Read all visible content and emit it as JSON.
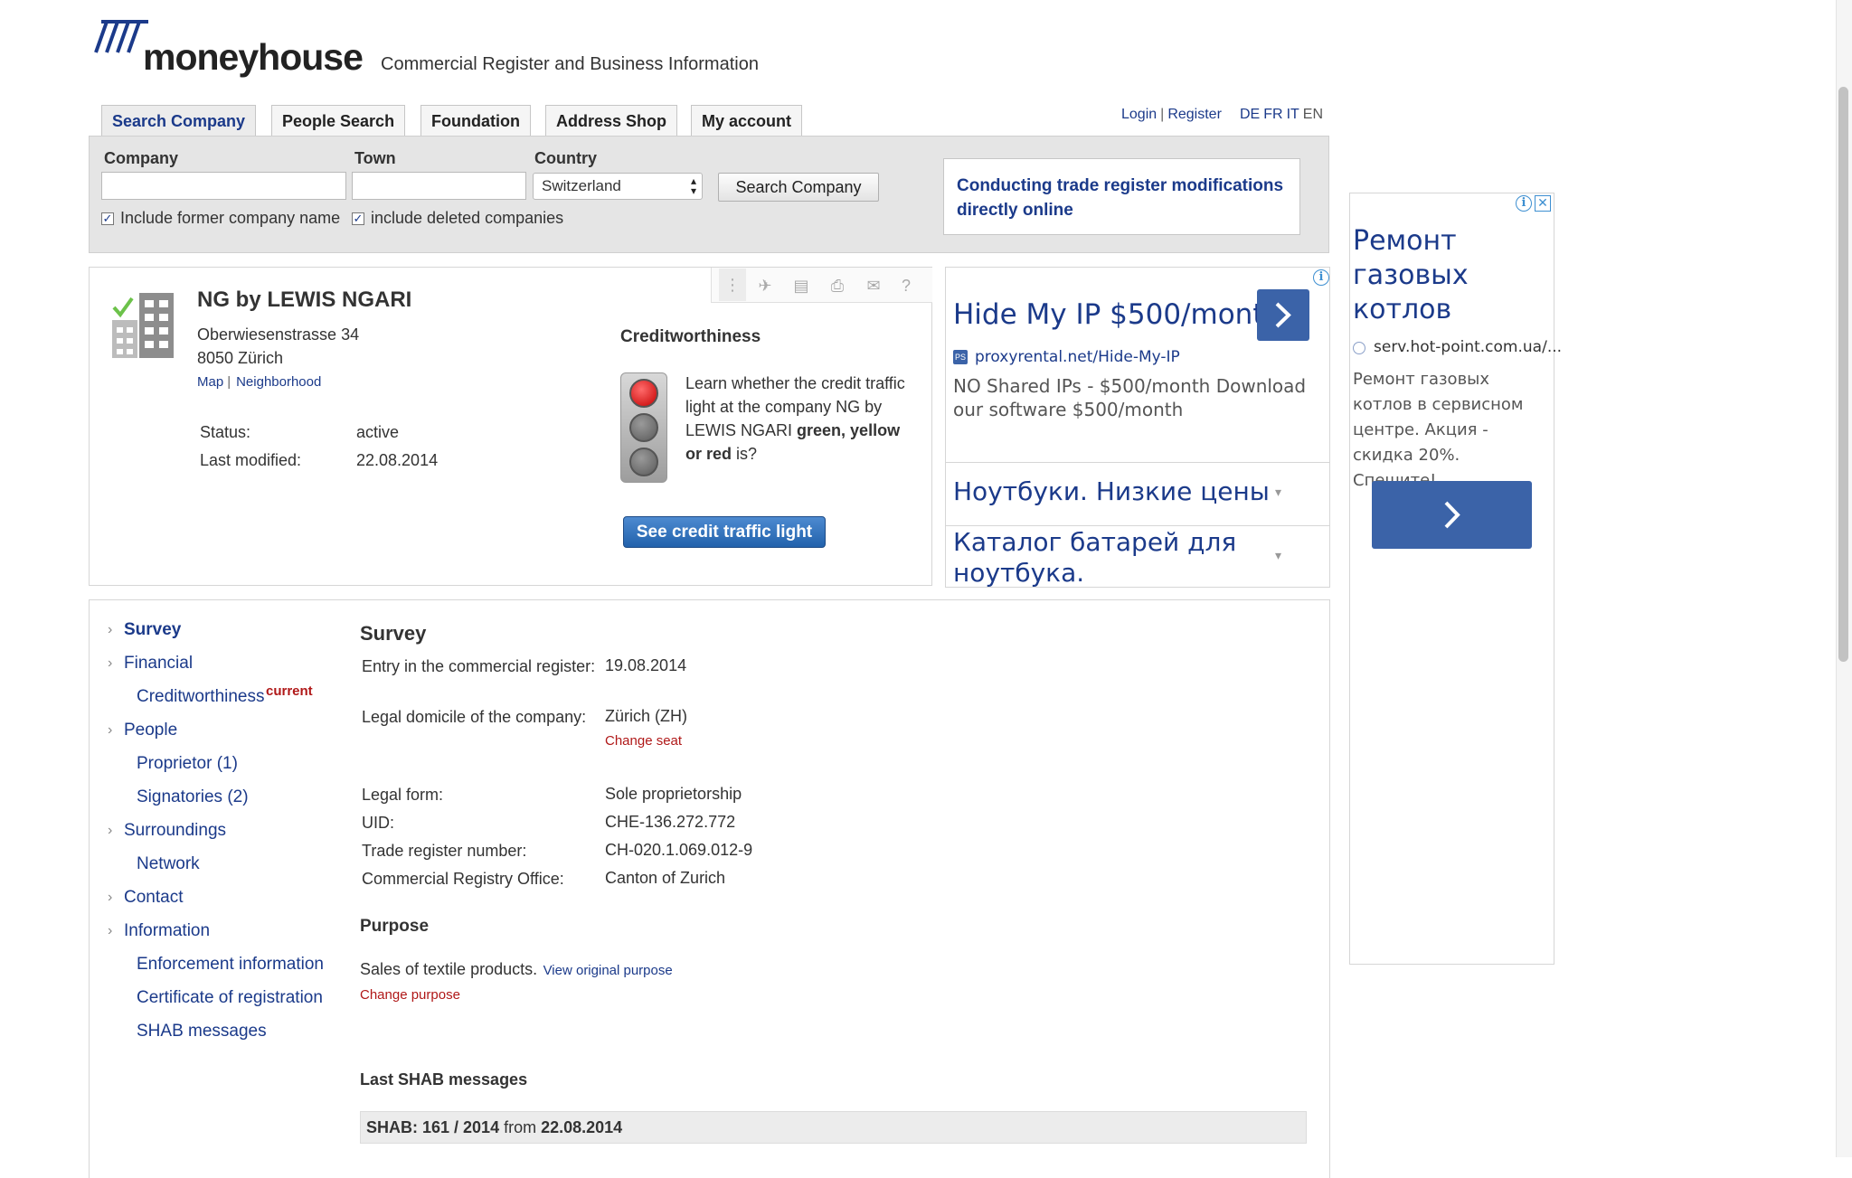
{
  "header": {
    "logo_text": "moneyhouse",
    "tagline": "Commercial Register and Business Information"
  },
  "tabs": [
    {
      "label": "Search Company"
    },
    {
      "label": "People Search"
    },
    {
      "label": "Foundation"
    },
    {
      "label": "Address Shop"
    },
    {
      "label": "My account"
    }
  ],
  "toplinks": {
    "login": "Login",
    "separator": "|",
    "register": "Register"
  },
  "languages": [
    "DE",
    "FR",
    "IT",
    "EN"
  ],
  "search": {
    "company_label": "Company",
    "town_label": "Town",
    "country_label": "Country",
    "company_value": "",
    "town_value": "",
    "country_selected": "Switzerland",
    "button_label": "Search Company",
    "include_former_label": "Include former company name",
    "include_deleted_label": "include deleted companies",
    "include_former_checked": true,
    "include_deleted_checked": true
  },
  "promo": {
    "text": "Conducting trade register modifications directly online"
  },
  "company": {
    "name": "NG by LEWIS NGARI",
    "street": "Oberwiesenstrasse 34",
    "city": "8050 Zürich",
    "map_link": "Map",
    "link_sep": "|",
    "neighborhood_link": "Neighborhood",
    "status_label": "Status:",
    "status_value": "active",
    "modified_label": "Last modified:",
    "modified_value": "22.08.2014"
  },
  "creditworthiness": {
    "title": "Creditworthiness",
    "text_1": "Learn whether the credit traffic light at the company NG by LEWIS NGARI ",
    "text_bold": "green, yellow or red",
    "text_2": " is?",
    "button_label": "See credit traffic light"
  },
  "toolbar_icons": [
    "bookmark-icon",
    "watch-icon",
    "document-icon",
    "print-icon",
    "email-icon",
    "help-icon"
  ],
  "help_glyph": "?",
  "ad1": {
    "headline": "Hide My IP $500/month",
    "url": "proxyrental.net/Hide-My-IP",
    "description": "NO Shared IPs - $500/month Download our software $500/month",
    "row1": "Ноутбуки. Низкие цены",
    "row2": "Каталог батарей для ноутбука."
  },
  "ad2": {
    "title": "Ремонт газовых котлов",
    "url": "serv.hot-point.com.ua/...",
    "description": "Ремонт газовых котлов в сервисном центре. Акция - скидка 20%. Спешите!"
  },
  "nav": {
    "survey": "Survey",
    "financial": "Financial",
    "creditworthiness": "Creditworthiness",
    "current_badge": "current",
    "people": "People",
    "proprietor": "Proprietor (1)",
    "signatories": "Signatories (2)",
    "surroundings": "Surroundings",
    "network": "Network",
    "contact": "Contact",
    "information": "Information",
    "enforcement": "Enforcement information",
    "certificate": "Certificate of registration",
    "shab": "SHAB messages"
  },
  "survey": {
    "title": "Survey",
    "entry_label": "Entry in the commercial register:",
    "entry_value": "19.08.2014",
    "domicile_label": "Legal domicile of the company:",
    "domicile_value": "Zürich (ZH)",
    "change_seat": "Change seat",
    "legal_form_label": "Legal form:",
    "legal_form_value": "Sole proprietorship",
    "uid_label": "UID:",
    "uid_value": "CHE-136.272.772",
    "trade_reg_label": "Trade register number:",
    "trade_reg_value": "CH-020.1.069.012-9",
    "office_label": "Commercial Registry Office:",
    "office_value": "Canton of Zurich",
    "purpose_title": "Purpose",
    "purpose_text": "Sales of textile products.",
    "view_original": "View original purpose",
    "change_purpose": "Change purpose",
    "shab_title": "Last SHAB messages",
    "shab_prefix": "SHAB: 161 / 2014",
    "shab_from": "from",
    "shab_date": "22.08.2014"
  },
  "colors": {
    "brand_blue": "#1b3a8a",
    "link_red": "#b01818",
    "ad_button": "#3b63a8",
    "button_blue": "#2262ac",
    "checkmark_green": "#6cc24a"
  }
}
